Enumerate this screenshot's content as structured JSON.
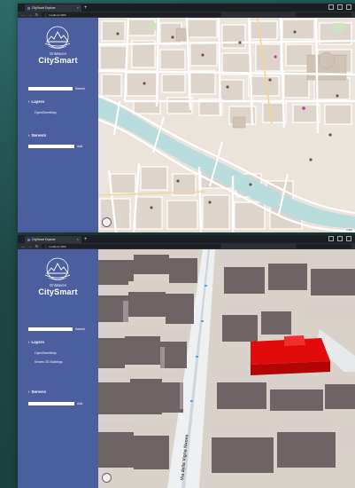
{
  "windows": [
    {
      "tab": {
        "title": "CitySmart Explorer"
      },
      "address": {
        "url": "localhost:3000"
      },
      "sidebar": {
        "brand_top": "OnMaven",
        "brand_main": "CitySmart",
        "search_label": "Search",
        "layers_heading": "Layers",
        "layers": [
          "OpenStreetMap"
        ],
        "servers_heading": "Servers",
        "add_label": "Add"
      },
      "map": {
        "attribution": "OSM"
      }
    },
    {
      "tab": {
        "title": "CitySmart Explorer"
      },
      "address": {
        "url": "localhost:3000"
      },
      "sidebar": {
        "brand_top": "OnMaven",
        "brand_main": "CitySmart",
        "search_label": "Search",
        "layers_heading": "Layers",
        "layers": [
          "OpenStreetMap",
          "Smarts 3D Buildings"
        ],
        "servers_heading": "Servers",
        "add_label": "Add"
      },
      "map": {
        "street_label": "Via della Vigna Nuova"
      }
    }
  ],
  "colors": {
    "sidebar": "#4b5f9e",
    "highlight_building": "#e10b0b",
    "river": "#b9dcdc",
    "land": "#ebe4dc"
  },
  "icons": [
    "logo-emblem",
    "back-icon",
    "forward-icon",
    "reload-icon",
    "chevron-right-icon",
    "compass-icon"
  ]
}
